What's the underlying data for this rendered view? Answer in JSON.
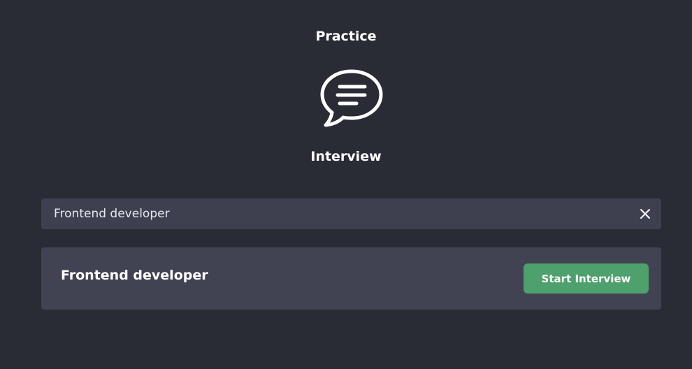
{
  "header": {
    "title": "Practice"
  },
  "section": {
    "icon": "chat-bubble-icon",
    "title": "Interview"
  },
  "search": {
    "value": "Frontend developer",
    "placeholder": "",
    "clear_icon": "close-icon"
  },
  "results": [
    {
      "title": "Frontend developer",
      "action_label": "Start Interview"
    }
  ],
  "colors": {
    "background": "#292b35",
    "input_background": "#3e404f",
    "card_background": "#414353",
    "accent": "#4ea06c",
    "text": "#ffffff"
  }
}
